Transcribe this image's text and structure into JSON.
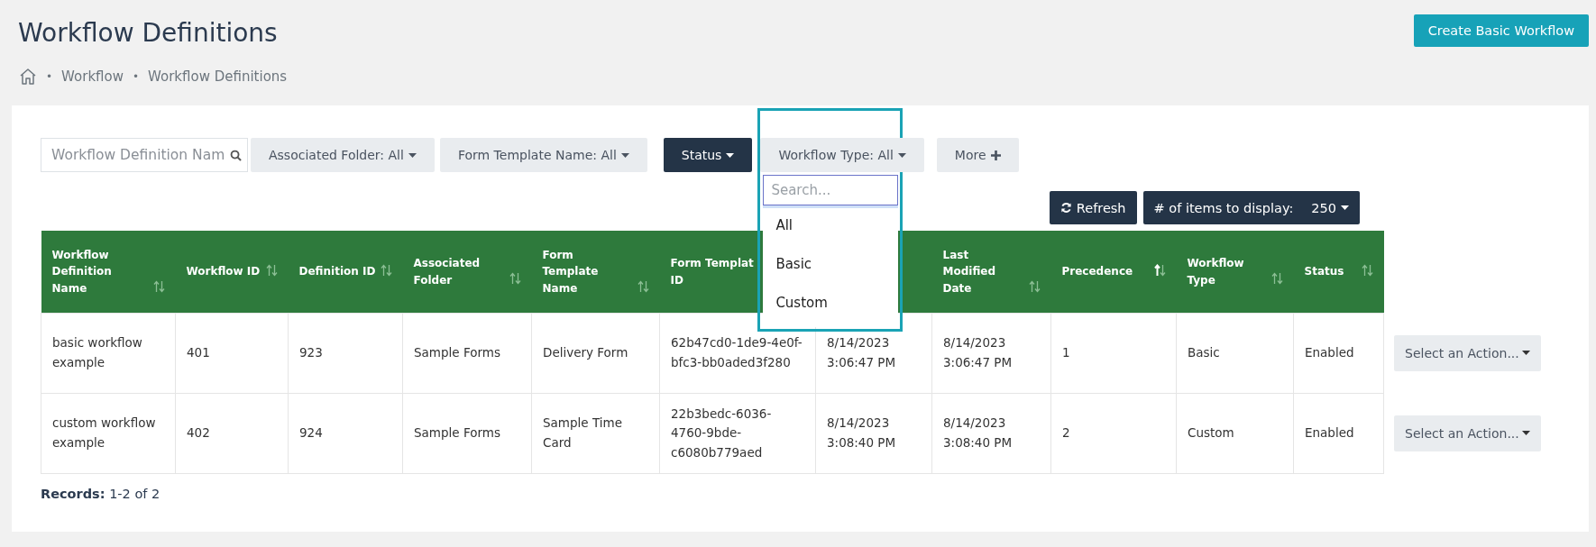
{
  "page": {
    "title": "Workflow Definitions",
    "create_button": "Create Basic Workflow"
  },
  "breadcrumb": [
    {
      "separator": "•",
      "label": "Workflow"
    },
    {
      "separator": "•",
      "label": "Workflow Definitions"
    }
  ],
  "filters": {
    "search_placeholder": "Workflow Definition Nam",
    "buttons": [
      {
        "label": "Associated Folder: All",
        "kind": "dropdown",
        "active": false
      },
      {
        "label": "Form Template Name: All",
        "kind": "dropdown",
        "active": false
      },
      {
        "label": "Status",
        "kind": "dropdown",
        "active": true
      },
      {
        "label": "Workflow Type: All",
        "kind": "dropdown",
        "active": false,
        "open": true
      },
      {
        "label": "More",
        "kind": "more",
        "active": false
      }
    ]
  },
  "workflow_type_menu": {
    "search_placeholder": "Search...",
    "options": [
      "All",
      "Basic",
      "Custom"
    ]
  },
  "toolbar": {
    "refresh": "Refresh",
    "items_label": "# of items to display:",
    "items_value": "250"
  },
  "table": {
    "columns": [
      {
        "label": "Workflow Definition Name",
        "sorted": false
      },
      {
        "label": "Workflow ID",
        "sorted": false
      },
      {
        "label": "Definition ID",
        "sorted": false
      },
      {
        "label": "Associated Folder",
        "sorted": false
      },
      {
        "label": "Form Template Name",
        "sorted": false
      },
      {
        "label": "Form Templat ID"
      },
      {},
      {
        "label": "Last Modified Date",
        "sorted": false
      },
      {
        "label": "Precedence",
        "sorted": true
      },
      {
        "label": "Workflow Type",
        "sorted": false
      },
      {
        "label": "Status",
        "sorted": false
      }
    ],
    "rows": [
      {
        "cells": [
          "basic workflow example",
          "401",
          "923",
          "Sample Forms",
          "Delivery Form",
          "62b47cd0-1de9-4e0f-bfc3-bb0aded3f280",
          "8/14/2023 3:06:47 PM",
          "8/14/2023 3:06:47 PM",
          "1",
          "Basic",
          "Enabled"
        ],
        "action": "Select an Action..."
      },
      {
        "cells": [
          "custom workflow example",
          "402",
          "924",
          "Sample Forms",
          "Sample Time Card",
          "22b3bedc-6036-4760-9bde-c6080b779aed",
          "8/14/2023 3:08:40 PM",
          "8/14/2023 3:08:40 PM",
          "2",
          "Custom",
          "Enabled"
        ],
        "action": "Select an Action..."
      }
    ]
  },
  "records": {
    "label": "Records:",
    "value": "1-2 of 2"
  }
}
